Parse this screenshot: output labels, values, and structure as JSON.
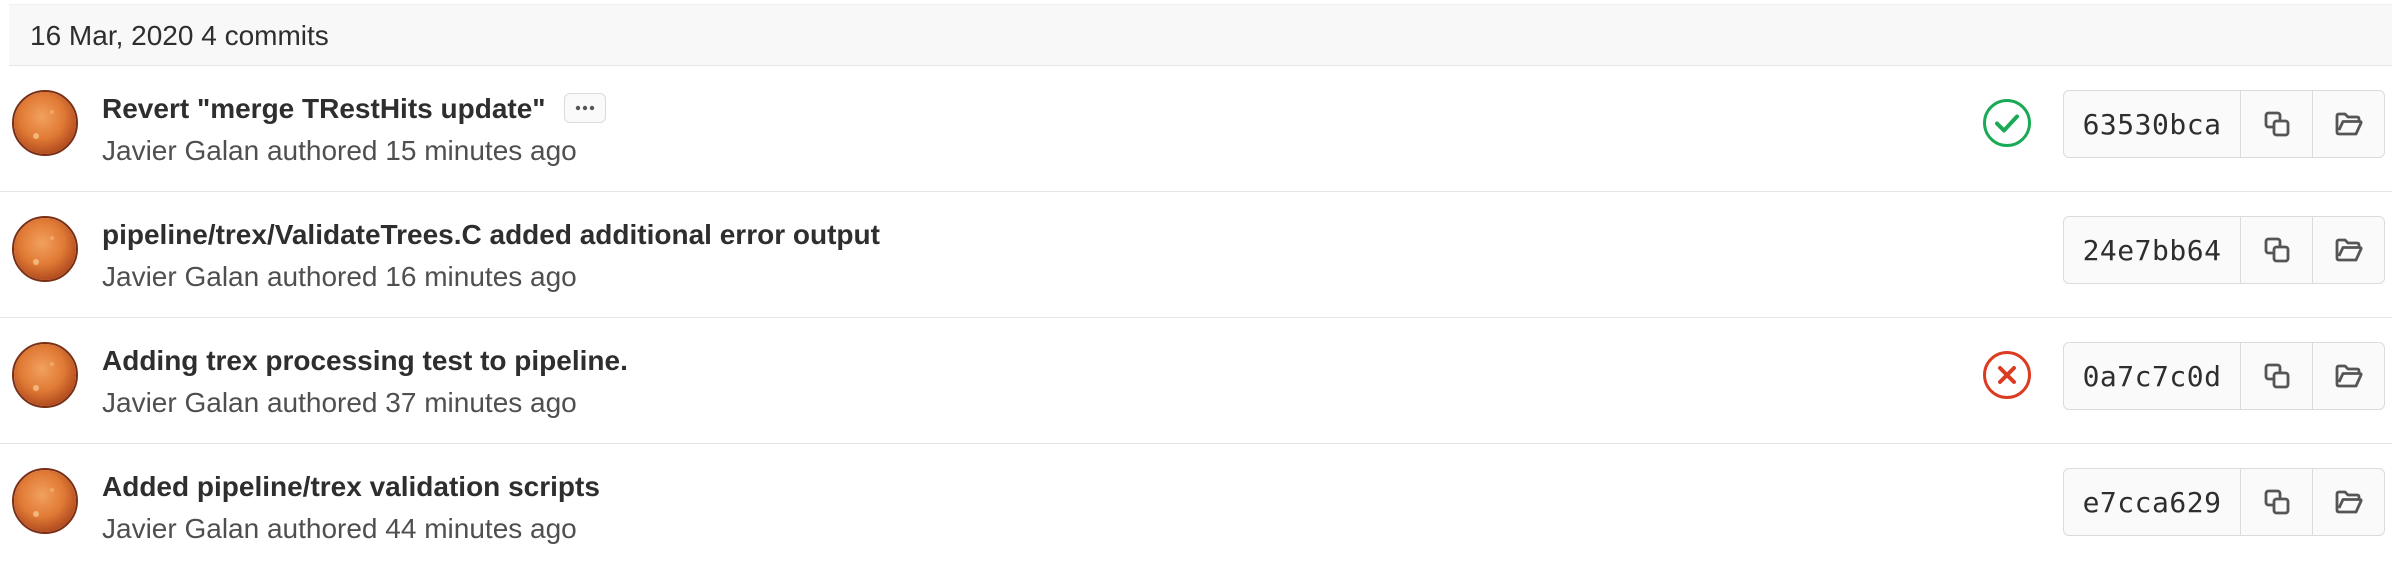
{
  "day_header": {
    "date": "16 Mar, 2020",
    "count": "4 commits"
  },
  "commits": [
    {
      "title": "Revert \"merge TRestHits update\"",
      "author": "Javier Galan",
      "authored_label": "authored",
      "time": "15 minutes ago",
      "sha": "63530bca",
      "status": "passed",
      "has_description_toggle": true
    },
    {
      "title": "pipeline/trex/ValidateTrees.C added additional error output",
      "author": "Javier Galan",
      "authored_label": "authored",
      "time": "16 minutes ago",
      "sha": "24e7bb64",
      "status": "none",
      "has_description_toggle": false
    },
    {
      "title": "Adding trex processing test to pipeline.",
      "author": "Javier Galan",
      "authored_label": "authored",
      "time": "37 minutes ago",
      "sha": "0a7c7c0d",
      "status": "failed",
      "has_description_toggle": false
    },
    {
      "title": "Added pipeline/trex validation scripts",
      "author": "Javier Galan",
      "authored_label": "authored",
      "time": "44 minutes ago",
      "sha": "e7cca629",
      "status": "none",
      "has_description_toggle": false
    }
  ],
  "icons": {
    "passed": "status-success-icon",
    "failed": "status-failed-icon",
    "copy": "copy-icon",
    "browse": "folder-open-icon",
    "ellipsis": "ellipsis-icon"
  },
  "colors": {
    "passed": "#1aaa55",
    "failed": "#db3b21",
    "avatar": "#e07a35"
  }
}
